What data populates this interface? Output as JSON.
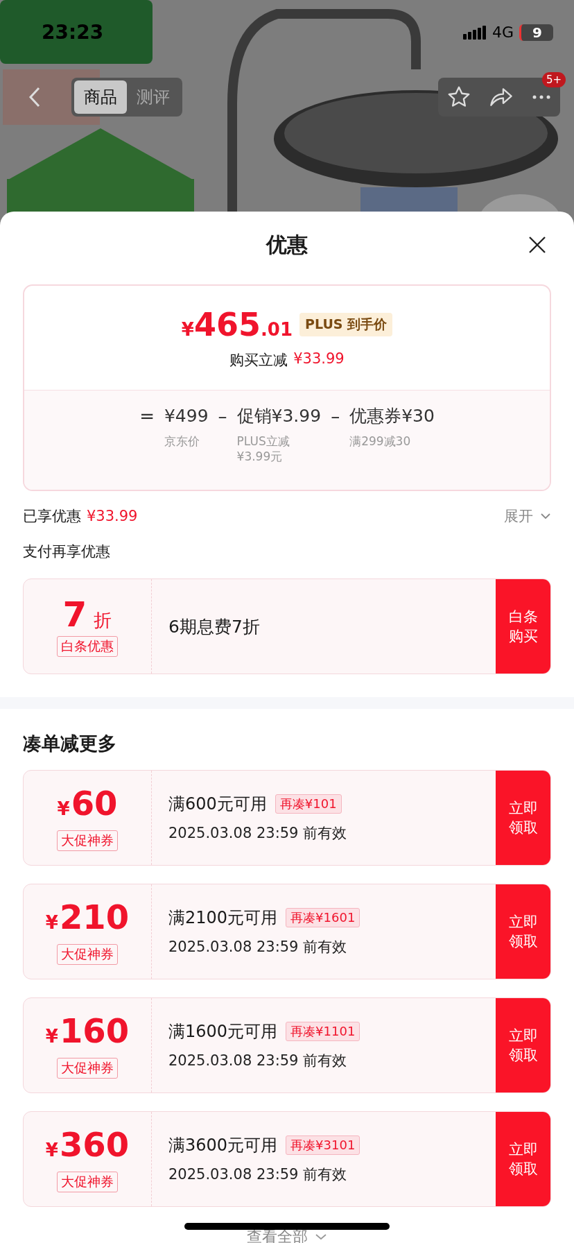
{
  "status_bar": {
    "time": "23:23",
    "network": "4G",
    "battery": "9"
  },
  "nav": {
    "tabs": [
      {
        "label": "商品",
        "selected": true
      },
      {
        "label": "测评",
        "selected": false
      }
    ],
    "badge": "5+"
  },
  "sheet": {
    "title": "优惠"
  },
  "price_card": {
    "currency": "¥",
    "price_integer": "465",
    "price_decimal": ".01",
    "price_tag": "PLUS 到手价",
    "saving_label": "购买立减",
    "saving_value": "¥33.99",
    "formula": [
      {
        "kind": "operator",
        "text": "="
      },
      {
        "kind": "term",
        "value": "¥499",
        "caption": "京东价"
      },
      {
        "kind": "operator",
        "text": "–"
      },
      {
        "kind": "term",
        "value": "促销¥3.99",
        "caption": "PLUS立减¥3.99元"
      },
      {
        "kind": "operator",
        "text": "–"
      },
      {
        "kind": "term",
        "value": "优惠券¥30",
        "caption": "满299减30"
      }
    ]
  },
  "enjoyed": {
    "label": "已享优惠",
    "value": "¥33.99",
    "toggle": "展开"
  },
  "payment": {
    "title": "支付再享优惠",
    "offer": {
      "discount": "7",
      "unit": "折",
      "tag": "白条优惠",
      "description": "6期息费7折",
      "button": "白条购买"
    }
  },
  "coupons": {
    "title": "凑单减更多",
    "items": [
      {
        "currency": "¥",
        "amount": "60",
        "tag": "大促神券",
        "condition": "满600元可用",
        "gap": "再凑¥101",
        "validity": "2025.03.08 23:59 前有效",
        "button": "立即领取"
      },
      {
        "currency": "¥",
        "amount": "210",
        "tag": "大促神券",
        "condition": "满2100元可用",
        "gap": "再凑¥1601",
        "validity": "2025.03.08 23:59 前有效",
        "button": "立即领取"
      },
      {
        "currency": "¥",
        "amount": "160",
        "tag": "大促神券",
        "condition": "满1600元可用",
        "gap": "再凑¥1101",
        "validity": "2025.03.08 23:59 前有效",
        "button": "立即领取"
      },
      {
        "currency": "¥",
        "amount": "360",
        "tag": "大促神券",
        "condition": "满3600元可用",
        "gap": "再凑¥3101",
        "validity": "2025.03.08 23:59 前有效",
        "button": "立即领取"
      }
    ],
    "view_all": "查看全部"
  }
}
